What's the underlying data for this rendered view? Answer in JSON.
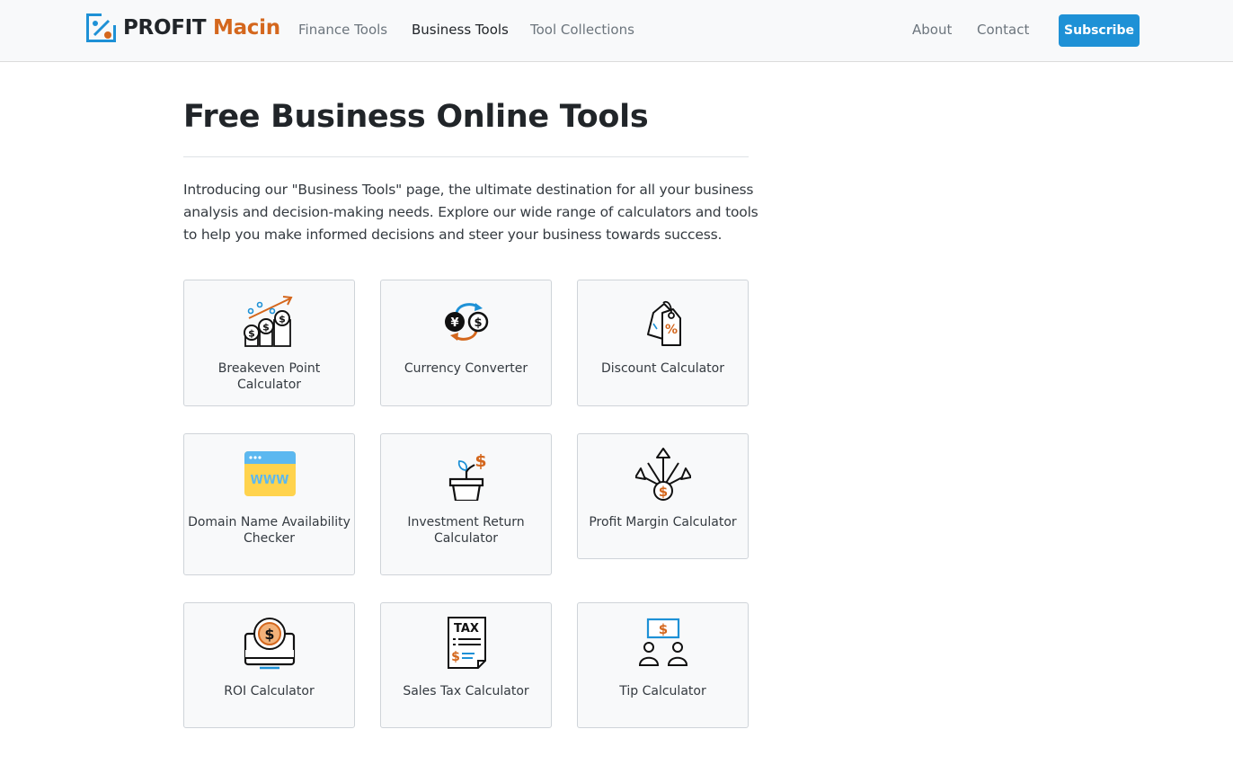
{
  "brand": {
    "name_part1": "PROFIT",
    "name_part2": "Macin",
    "logo_icon": "percent-chart-icon"
  },
  "nav": {
    "items": [
      {
        "label": "Finance Tools",
        "active": false
      },
      {
        "label": "Business Tools",
        "active": true
      },
      {
        "label": "Tool Collections",
        "active": false
      }
    ],
    "right": [
      {
        "label": "About"
      },
      {
        "label": "Contact"
      }
    ],
    "subscribe_label": "Subscribe"
  },
  "page": {
    "title": "Free Business Online Tools",
    "intro": "Introducing our \"Business Tools\" page, the ultimate destination for all your business analysis and decision-making needs. Explore our wide range of calculators and tools to help you make informed decisions and steer your business towards success."
  },
  "tools": [
    {
      "label": "Breakeven Point Calculator",
      "icon": "breakeven-coins-icon"
    },
    {
      "label": "Currency Converter",
      "icon": "currency-exchange-icon"
    },
    {
      "label": "Discount Calculator",
      "icon": "discount-tag-icon"
    },
    {
      "label": "Domain Name Availability Checker",
      "icon": "www-browser-icon"
    },
    {
      "label": "Investment Return Calculator",
      "icon": "plant-pot-dollar-icon"
    },
    {
      "label": "Profit Margin Calculator",
      "icon": "dollar-arrows-icon"
    },
    {
      "label": "ROI Calculator",
      "icon": "monitor-dollar-icon"
    },
    {
      "label": "Sales Tax Calculator",
      "icon": "tax-receipt-icon"
    },
    {
      "label": "Tip Calculator",
      "icon": "people-dollar-icon"
    }
  ],
  "colors": {
    "accent": "#1e91d6",
    "brand_orange": "#d4671d",
    "card_bg": "#f8f9fa"
  }
}
